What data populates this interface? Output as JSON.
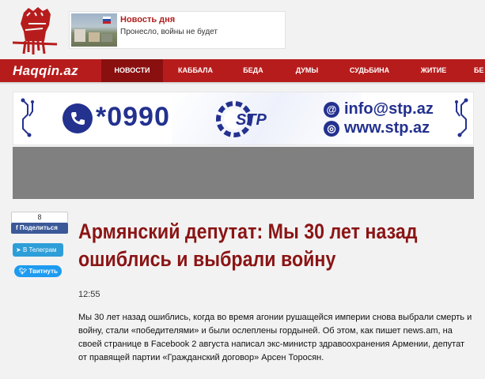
{
  "site": {
    "brand": "Haqqin.az"
  },
  "news_of_day": {
    "title": "Новость дня",
    "subtitle": "Пронесло, войны не будет"
  },
  "nav": {
    "items": [
      {
        "label": "НОВОСТИ",
        "active": true
      },
      {
        "label": "КАББАЛА",
        "active": false
      },
      {
        "label": "БЕДА",
        "active": false
      },
      {
        "label": "ДУМЫ",
        "active": false
      },
      {
        "label": "СУДЬБИНА",
        "active": false
      },
      {
        "label": "ЖИТИЕ",
        "active": false
      },
      {
        "label": "БЕ",
        "active": false
      }
    ]
  },
  "banner": {
    "phone": "*0990",
    "logo_text": "STP",
    "email": "info@stp.az",
    "website": "www.stp.az",
    "brand_color": "#23318f"
  },
  "share": {
    "fb_count": "8",
    "fb_label": "Поделиться",
    "tg_label": "В Телеграм",
    "tw_label": "Твитнуть"
  },
  "article": {
    "title": "Армянский депутат: Мы 30 лет назад ошиблись и выбрали войну",
    "time": "12:55",
    "lead": "Мы 30 лет назад ошиблись, когда во время агонии рушащейся империи снова выбрали смерть и войну, стали «победителями» и были ослеплены гордыней. Об этом, как пишет news.am, на своей странице в Facebook 2 августа написал экс-министр здравоохранения Армении, депутат от правящей партии «Гражданский договор» Арсен Торосян."
  },
  "colors": {
    "nav_red": "#b71c1c",
    "title_red": "#8b1414",
    "facebook": "#3b5998",
    "telegram": "#2d9ed8",
    "twitter": "#1d9bf0"
  }
}
